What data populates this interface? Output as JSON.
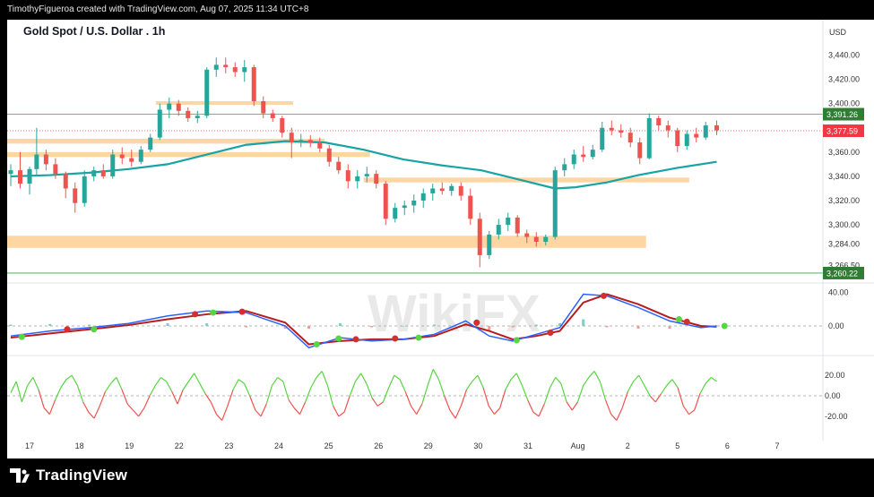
{
  "header": {
    "attribution": "TimothyFigueroa created with TradingView.com, Aug 07, 2025 11:34 UTC+8"
  },
  "footer": {
    "brand": "TradingView"
  },
  "watermark": {
    "text": "WikiFX"
  },
  "colors": {
    "up": "#26a69a",
    "down": "#ef5350",
    "ma": "#19a3a3",
    "zone": "#fdd29a",
    "macd": "#2962ff",
    "signal": "#b71c1c",
    "osc_up": "#56d640",
    "osc_down": "#ef5350"
  },
  "chart_data": {
    "type": "candlestick",
    "title": "Gold Spot / U.S. Dollar . 1h",
    "currency": "USD",
    "x_labels": [
      "17",
      "18",
      "19",
      "22",
      "23",
      "24",
      "25",
      "26",
      "29",
      "30",
      "31",
      "Aug",
      "2",
      "5",
      "6",
      "7"
    ],
    "price_axis": {
      "ylim": [
        3255,
        3450
      ],
      "ticks": [
        "3,440.00",
        "3,420.00",
        "3,400.00",
        "3,380.00",
        "3,360.00",
        "3,340.00",
        "3,320.00",
        "3,300.00",
        "3,284.00",
        "3,266.50"
      ],
      "tick_values": [
        3440,
        3420,
        3400,
        3380,
        3360,
        3340,
        3320,
        3300,
        3284,
        3266.5
      ],
      "badges": [
        {
          "label": "3,391.26",
          "value": 3391.26,
          "color": "#2e7d32"
        },
        {
          "label": "3,377.59",
          "value": 3377.59,
          "color": "#f23645"
        },
        {
          "label": "3,260.22",
          "value": 3260.22,
          "color": "#2e7d32"
        }
      ]
    },
    "horizontal_lines": [
      3391.26,
      3260.22
    ],
    "last_price": 3377.59,
    "zones": [
      {
        "from_x": 0.185,
        "to_x": 0.36,
        "y_low": 3399,
        "y_high": 3402
      },
      {
        "from_x": 0.0,
        "to_x": 0.4,
        "y_low": 3367,
        "y_high": 3371
      },
      {
        "from_x": 0.0,
        "to_x": 0.458,
        "y_low": 3356,
        "y_high": 3360
      },
      {
        "from_x": 0.45,
        "to_x": 0.865,
        "y_low": 3335,
        "y_high": 3339
      },
      {
        "from_x": 0.0,
        "to_x": 0.81,
        "y_low": 3281,
        "y_high": 3291
      }
    ],
    "candles": [
      {
        "x": 0.0,
        "o": 3342,
        "h": 3350,
        "l": 3332,
        "c": 3345
      },
      {
        "x": 0.012,
        "o": 3345,
        "h": 3360,
        "l": 3330,
        "c": 3334
      },
      {
        "x": 0.024,
        "o": 3334,
        "h": 3348,
        "l": 3325,
        "c": 3346
      },
      {
        "x": 0.033,
        "o": 3346,
        "h": 3380,
        "l": 3340,
        "c": 3358
      },
      {
        "x": 0.045,
        "o": 3358,
        "h": 3362,
        "l": 3345,
        "c": 3350
      },
      {
        "x": 0.057,
        "o": 3350,
        "h": 3355,
        "l": 3338,
        "c": 3342
      },
      {
        "x": 0.07,
        "o": 3342,
        "h": 3344,
        "l": 3322,
        "c": 3330
      },
      {
        "x": 0.082,
        "o": 3330,
        "h": 3335,
        "l": 3310,
        "c": 3318
      },
      {
        "x": 0.094,
        "o": 3318,
        "h": 3345,
        "l": 3315,
        "c": 3340
      },
      {
        "x": 0.106,
        "o": 3340,
        "h": 3348,
        "l": 3336,
        "c": 3345
      },
      {
        "x": 0.118,
        "o": 3345,
        "h": 3350,
        "l": 3338,
        "c": 3340
      },
      {
        "x": 0.13,
        "o": 3340,
        "h": 3362,
        "l": 3338,
        "c": 3358
      },
      {
        "x": 0.142,
        "o": 3358,
        "h": 3364,
        "l": 3350,
        "c": 3355
      },
      {
        "x": 0.154,
        "o": 3355,
        "h": 3362,
        "l": 3348,
        "c": 3352
      },
      {
        "x": 0.166,
        "o": 3352,
        "h": 3365,
        "l": 3350,
        "c": 3362
      },
      {
        "x": 0.178,
        "o": 3362,
        "h": 3375,
        "l": 3360,
        "c": 3372
      },
      {
        "x": 0.19,
        "o": 3372,
        "h": 3400,
        "l": 3370,
        "c": 3395
      },
      {
        "x": 0.202,
        "o": 3395,
        "h": 3405,
        "l": 3388,
        "c": 3400
      },
      {
        "x": 0.214,
        "o": 3400,
        "h": 3403,
        "l": 3390,
        "c": 3394
      },
      {
        "x": 0.226,
        "o": 3394,
        "h": 3397,
        "l": 3385,
        "c": 3388
      },
      {
        "x": 0.238,
        "o": 3388,
        "h": 3394,
        "l": 3384,
        "c": 3390
      },
      {
        "x": 0.25,
        "o": 3390,
        "h": 3430,
        "l": 3388,
        "c": 3428
      },
      {
        "x": 0.262,
        "o": 3428,
        "h": 3438,
        "l": 3422,
        "c": 3432
      },
      {
        "x": 0.274,
        "o": 3432,
        "h": 3438,
        "l": 3425,
        "c": 3430
      },
      {
        "x": 0.286,
        "o": 3430,
        "h": 3434,
        "l": 3422,
        "c": 3426
      },
      {
        "x": 0.298,
        "o": 3426,
        "h": 3436,
        "l": 3418,
        "c": 3430
      },
      {
        "x": 0.31,
        "o": 3430,
        "h": 3432,
        "l": 3398,
        "c": 3402
      },
      {
        "x": 0.322,
        "o": 3402,
        "h": 3406,
        "l": 3388,
        "c": 3392
      },
      {
        "x": 0.334,
        "o": 3392,
        "h": 3395,
        "l": 3385,
        "c": 3388
      },
      {
        "x": 0.346,
        "o": 3388,
        "h": 3390,
        "l": 3372,
        "c": 3376
      },
      {
        "x": 0.358,
        "o": 3376,
        "h": 3380,
        "l": 3355,
        "c": 3368
      },
      {
        "x": 0.37,
        "o": 3368,
        "h": 3375,
        "l": 3364,
        "c": 3370
      },
      {
        "x": 0.382,
        "o": 3370,
        "h": 3374,
        "l": 3364,
        "c": 3368
      },
      {
        "x": 0.394,
        "o": 3368,
        "h": 3372,
        "l": 3360,
        "c": 3363
      },
      {
        "x": 0.406,
        "o": 3363,
        "h": 3366,
        "l": 3348,
        "c": 3352
      },
      {
        "x": 0.418,
        "o": 3352,
        "h": 3356,
        "l": 3342,
        "c": 3345
      },
      {
        "x": 0.43,
        "o": 3345,
        "h": 3350,
        "l": 3330,
        "c": 3336
      },
      {
        "x": 0.442,
        "o": 3336,
        "h": 3345,
        "l": 3330,
        "c": 3340
      },
      {
        "x": 0.454,
        "o": 3340,
        "h": 3348,
        "l": 3335,
        "c": 3342
      },
      {
        "x": 0.466,
        "o": 3342,
        "h": 3345,
        "l": 3330,
        "c": 3334
      },
      {
        "x": 0.478,
        "o": 3334,
        "h": 3336,
        "l": 3300,
        "c": 3305
      },
      {
        "x": 0.49,
        "o": 3305,
        "h": 3318,
        "l": 3302,
        "c": 3314
      },
      {
        "x": 0.502,
        "o": 3314,
        "h": 3320,
        "l": 3308,
        "c": 3316
      },
      {
        "x": 0.514,
        "o": 3316,
        "h": 3325,
        "l": 3310,
        "c": 3320
      },
      {
        "x": 0.526,
        "o": 3320,
        "h": 3330,
        "l": 3314,
        "c": 3326
      },
      {
        "x": 0.538,
        "o": 3326,
        "h": 3334,
        "l": 3320,
        "c": 3330
      },
      {
        "x": 0.55,
        "o": 3330,
        "h": 3335,
        "l": 3325,
        "c": 3328
      },
      {
        "x": 0.562,
        "o": 3328,
        "h": 3334,
        "l": 3324,
        "c": 3332
      },
      {
        "x": 0.574,
        "o": 3332,
        "h": 3335,
        "l": 3320,
        "c": 3324
      },
      {
        "x": 0.586,
        "o": 3324,
        "h": 3330,
        "l": 3300,
        "c": 3305
      },
      {
        "x": 0.598,
        "o": 3305,
        "h": 3310,
        "l": 3265,
        "c": 3275
      },
      {
        "x": 0.61,
        "o": 3275,
        "h": 3295,
        "l": 3272,
        "c": 3292
      },
      {
        "x": 0.622,
        "o": 3292,
        "h": 3305,
        "l": 3288,
        "c": 3300
      },
      {
        "x": 0.634,
        "o": 3300,
        "h": 3310,
        "l": 3295,
        "c": 3306
      },
      {
        "x": 0.646,
        "o": 3306,
        "h": 3308,
        "l": 3290,
        "c": 3293
      },
      {
        "x": 0.658,
        "o": 3293,
        "h": 3296,
        "l": 3285,
        "c": 3290
      },
      {
        "x": 0.67,
        "o": 3290,
        "h": 3294,
        "l": 3282,
        "c": 3286
      },
      {
        "x": 0.682,
        "o": 3286,
        "h": 3292,
        "l": 3283,
        "c": 3290
      },
      {
        "x": 0.694,
        "o": 3290,
        "h": 3348,
        "l": 3288,
        "c": 3345
      },
      {
        "x": 0.706,
        "o": 3345,
        "h": 3355,
        "l": 3340,
        "c": 3350
      },
      {
        "x": 0.718,
        "o": 3350,
        "h": 3362,
        "l": 3346,
        "c": 3358
      },
      {
        "x": 0.73,
        "o": 3358,
        "h": 3365,
        "l": 3352,
        "c": 3356
      },
      {
        "x": 0.742,
        "o": 3356,
        "h": 3366,
        "l": 3354,
        "c": 3362
      },
      {
        "x": 0.754,
        "o": 3362,
        "h": 3385,
        "l": 3360,
        "c": 3380
      },
      {
        "x": 0.766,
        "o": 3380,
        "h": 3386,
        "l": 3374,
        "c": 3378
      },
      {
        "x": 0.778,
        "o": 3378,
        "h": 3383,
        "l": 3372,
        "c": 3376
      },
      {
        "x": 0.79,
        "o": 3376,
        "h": 3380,
        "l": 3364,
        "c": 3368
      },
      {
        "x": 0.802,
        "o": 3368,
        "h": 3372,
        "l": 3350,
        "c": 3355
      },
      {
        "x": 0.814,
        "o": 3355,
        "h": 3392,
        "l": 3354,
        "c": 3388
      },
      {
        "x": 0.826,
        "o": 3388,
        "h": 3390,
        "l": 3378,
        "c": 3382
      },
      {
        "x": 0.838,
        "o": 3382,
        "h": 3386,
        "l": 3372,
        "c": 3378
      },
      {
        "x": 0.85,
        "o": 3378,
        "h": 3380,
        "l": 3360,
        "c": 3365
      },
      {
        "x": 0.862,
        "o": 3365,
        "h": 3378,
        "l": 3362,
        "c": 3375
      },
      {
        "x": 0.874,
        "o": 3375,
        "h": 3380,
        "l": 3368,
        "c": 3372
      },
      {
        "x": 0.886,
        "o": 3372,
        "h": 3385,
        "l": 3370,
        "c": 3382
      },
      {
        "x": 0.9,
        "o": 3382,
        "h": 3386,
        "l": 3374,
        "c": 3378
      }
    ],
    "ma_line": [
      [
        0.0,
        3340
      ],
      [
        0.05,
        3341
      ],
      [
        0.1,
        3343
      ],
      [
        0.15,
        3346
      ],
      [
        0.2,
        3350
      ],
      [
        0.25,
        3358
      ],
      [
        0.3,
        3366
      ],
      [
        0.35,
        3369
      ],
      [
        0.4,
        3368
      ],
      [
        0.45,
        3362
      ],
      [
        0.5,
        3354
      ],
      [
        0.55,
        3349
      ],
      [
        0.6,
        3345
      ],
      [
        0.65,
        3337
      ],
      [
        0.694,
        3330
      ],
      [
        0.72,
        3331
      ],
      [
        0.76,
        3335
      ],
      [
        0.8,
        3341
      ],
      [
        0.85,
        3347
      ],
      [
        0.9,
        3352
      ]
    ],
    "macd_panel": {
      "ticks": [
        "40.00",
        "0.00"
      ],
      "tick_values": [
        40,
        0
      ],
      "ylim": [
        -30,
        45
      ],
      "macd": [
        [
          0.0,
          -12
        ],
        [
          0.05,
          -6
        ],
        [
          0.1,
          -2
        ],
        [
          0.15,
          3
        ],
        [
          0.2,
          12
        ],
        [
          0.25,
          18
        ],
        [
          0.3,
          16
        ],
        [
          0.35,
          0
        ],
        [
          0.38,
          -26
        ],
        [
          0.42,
          -14
        ],
        [
          0.46,
          -18
        ],
        [
          0.5,
          -16
        ],
        [
          0.54,
          -10
        ],
        [
          0.58,
          6
        ],
        [
          0.61,
          -12
        ],
        [
          0.64,
          -18
        ],
        [
          0.67,
          -10
        ],
        [
          0.7,
          -2
        ],
        [
          0.73,
          38
        ],
        [
          0.76,
          36
        ],
        [
          0.8,
          22
        ],
        [
          0.84,
          6
        ],
        [
          0.88,
          -2
        ],
        [
          0.9,
          0
        ]
      ],
      "signal": [
        [
          0.0,
          -14
        ],
        [
          0.05,
          -9
        ],
        [
          0.1,
          -4
        ],
        [
          0.15,
          1
        ],
        [
          0.2,
          8
        ],
        [
          0.25,
          14
        ],
        [
          0.3,
          18
        ],
        [
          0.35,
          4
        ],
        [
          0.38,
          -22
        ],
        [
          0.42,
          -18
        ],
        [
          0.46,
          -16
        ],
        [
          0.5,
          -16
        ],
        [
          0.54,
          -12
        ],
        [
          0.58,
          2
        ],
        [
          0.61,
          -6
        ],
        [
          0.64,
          -16
        ],
        [
          0.67,
          -12
        ],
        [
          0.7,
          -6
        ],
        [
          0.73,
          28
        ],
        [
          0.76,
          38
        ],
        [
          0.8,
          26
        ],
        [
          0.84,
          10
        ],
        [
          0.88,
          0
        ],
        [
          0.9,
          -1
        ]
      ],
      "cross_dots": [
        {
          "x": 0.014,
          "v": -13,
          "color": "#56d640"
        },
        {
          "x": 0.072,
          "v": -4,
          "color": "#d32f2f"
        },
        {
          "x": 0.106,
          "v": -4,
          "color": "#56d640"
        },
        {
          "x": 0.235,
          "v": 14,
          "color": "#d32f2f"
        },
        {
          "x": 0.258,
          "v": 16,
          "color": "#56d640"
        },
        {
          "x": 0.295,
          "v": 17,
          "color": "#d32f2f"
        },
        {
          "x": 0.39,
          "v": -22,
          "color": "#56d640"
        },
        {
          "x": 0.418,
          "v": -15,
          "color": "#56d640"
        },
        {
          "x": 0.44,
          "v": -16,
          "color": "#d32f2f"
        },
        {
          "x": 0.49,
          "v": -15,
          "color": "#d32f2f"
        },
        {
          "x": 0.52,
          "v": -14,
          "color": "#56d640"
        },
        {
          "x": 0.594,
          "v": 4,
          "color": "#d32f2f"
        },
        {
          "x": 0.645,
          "v": -17,
          "color": "#56d640"
        },
        {
          "x": 0.688,
          "v": -8,
          "color": "#d32f2f"
        },
        {
          "x": 0.756,
          "v": 36,
          "color": "#d32f2f"
        },
        {
          "x": 0.852,
          "v": 8,
          "color": "#56d640"
        },
        {
          "x": 0.862,
          "v": 5,
          "color": "#d32f2f"
        },
        {
          "x": 0.91,
          "v": 0,
          "color": "#56d640"
        }
      ]
    },
    "osc_panel": {
      "ticks": [
        "20.00",
        "0.00",
        "-20.00"
      ],
      "tick_values": [
        20,
        0,
        -20
      ],
      "ylim": [
        -35,
        35
      ],
      "values": [
        3,
        14,
        -6,
        10,
        18,
        6,
        -12,
        -18,
        -4,
        8,
        16,
        20,
        10,
        -6,
        -16,
        -22,
        -10,
        4,
        12,
        18,
        6,
        -8,
        -14,
        -20,
        -12,
        0,
        10,
        18,
        14,
        4,
        -8,
        6,
        14,
        22,
        12,
        2,
        -6,
        -18,
        -24,
        -10,
        6,
        16,
        12,
        0,
        -14,
        -20,
        -8,
        10,
        18,
        14,
        -4,
        -12,
        -18,
        -6,
        8,
        18,
        24,
        10,
        -10,
        -20,
        -16,
        0,
        14,
        22,
        12,
        -2,
        -10,
        -6,
        8,
        20,
        16,
        4,
        -10,
        -18,
        -8,
        10,
        26,
        16,
        0,
        -14,
        -22,
        -10,
        6,
        14,
        20,
        8,
        -10,
        -18,
        -12,
        6,
        16,
        22,
        10,
        -4,
        -16,
        -20,
        -8,
        8,
        18,
        12,
        -6,
        -14,
        -6,
        10,
        18,
        24,
        14,
        -4,
        -18,
        -24,
        -12,
        4,
        14,
        20,
        10,
        0,
        -6,
        2,
        10,
        16,
        8,
        -10,
        -18,
        -14,
        2,
        12,
        18,
        14
      ]
    }
  }
}
